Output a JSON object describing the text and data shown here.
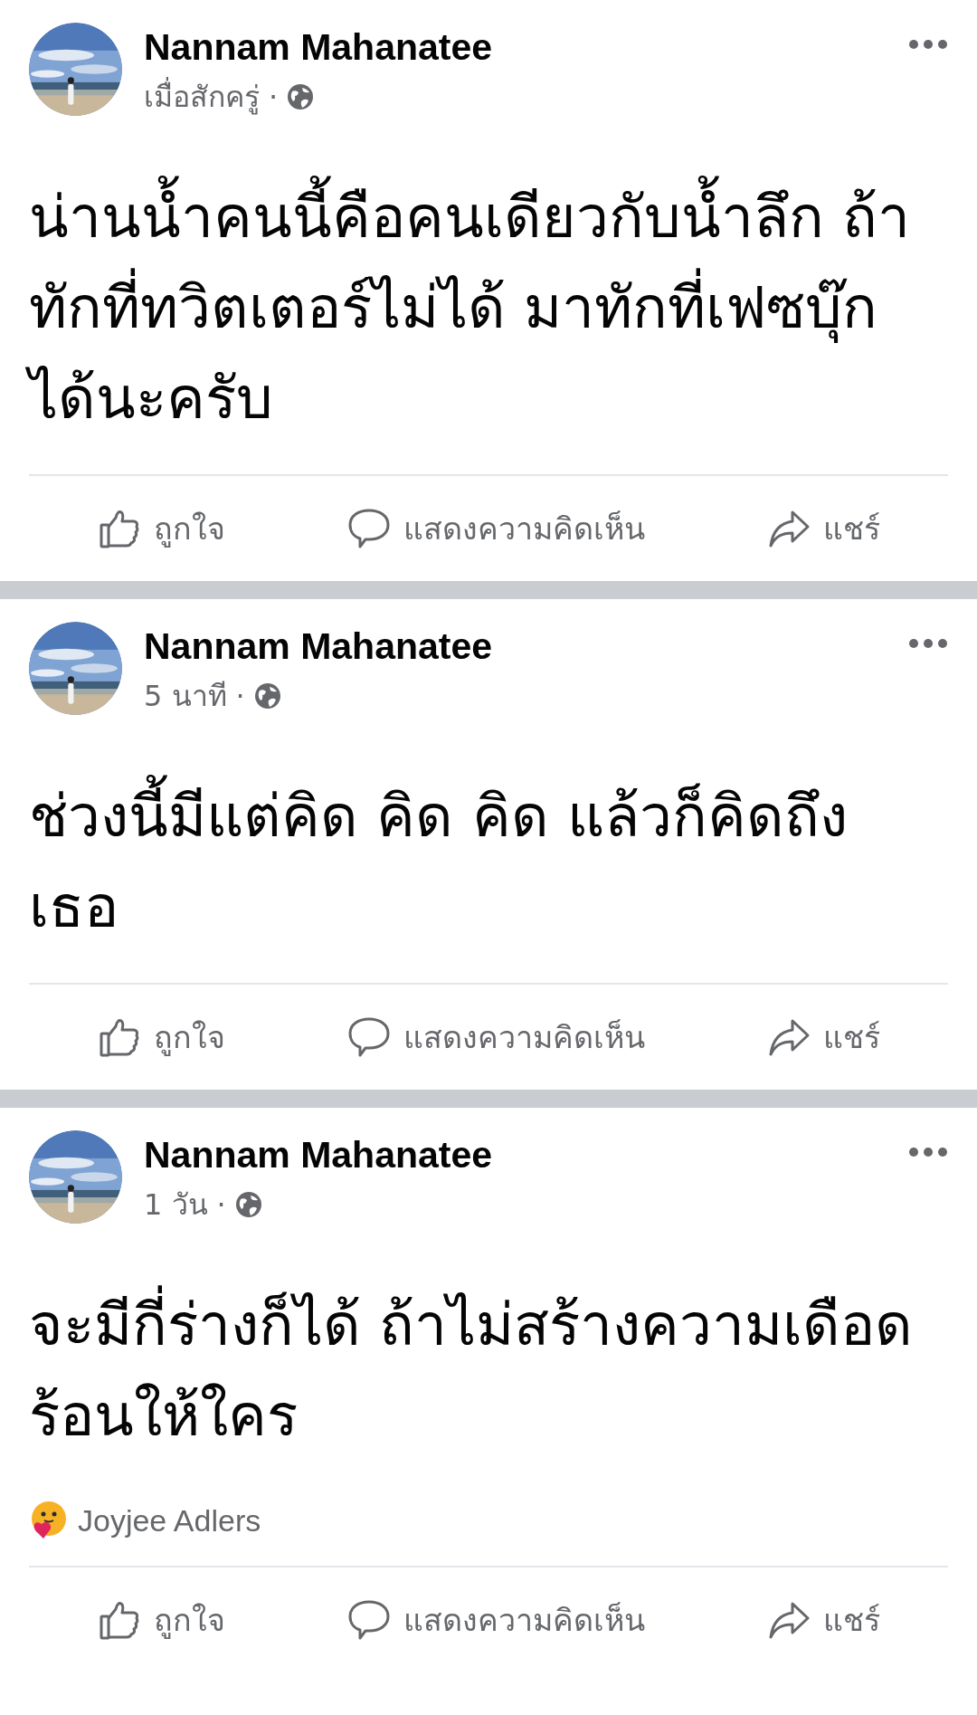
{
  "posts": [
    {
      "author": "Nannam Mahanatee",
      "time": "เมื่อสักครู่",
      "separator": "·",
      "body_lines": [
        "น่านน้ำคนนี้คือคนเดียวกับน้ำลึก ถ้า",
        "ทักที่ทวิตเตอร์ไม่ได้ มาทักที่เฟซบุ๊ก",
        "ได้นะครับ"
      ],
      "actions": [
        {
          "kind": "like",
          "label": "ถูกใจ"
        },
        {
          "kind": "comment",
          "label": "แสดงความคิดเห็น"
        },
        {
          "kind": "share",
          "label": "แชร์"
        }
      ]
    },
    {
      "author": "Nannam Mahanatee",
      "time": "5 นาที",
      "separator": "·",
      "body_lines": [
        "ช่วงนี้มีแต่คิด คิด คิด แล้วก็คิดถึง",
        "เธอ"
      ],
      "actions": [
        {
          "kind": "like",
          "label": "ถูกใจ"
        },
        {
          "kind": "comment",
          "label": "แสดงความคิดเห็น"
        },
        {
          "kind": "share",
          "label": "แชร์"
        }
      ]
    },
    {
      "author": "Nannam Mahanatee",
      "time": "1 วัน",
      "separator": "·",
      "body_lines": [
        "จะมีกี่ร่างก็ได้ ถ้าไม่สร้างความเดือด",
        "ร้อนให้ใคร"
      ],
      "reaction": {
        "name": "Joyjee Adlers"
      },
      "actions": [
        {
          "kind": "like",
          "label": "ถูกใจ"
        },
        {
          "kind": "comment",
          "label": "แสดงความคิดเห็น"
        },
        {
          "kind": "share",
          "label": "แชร์"
        }
      ]
    }
  ]
}
